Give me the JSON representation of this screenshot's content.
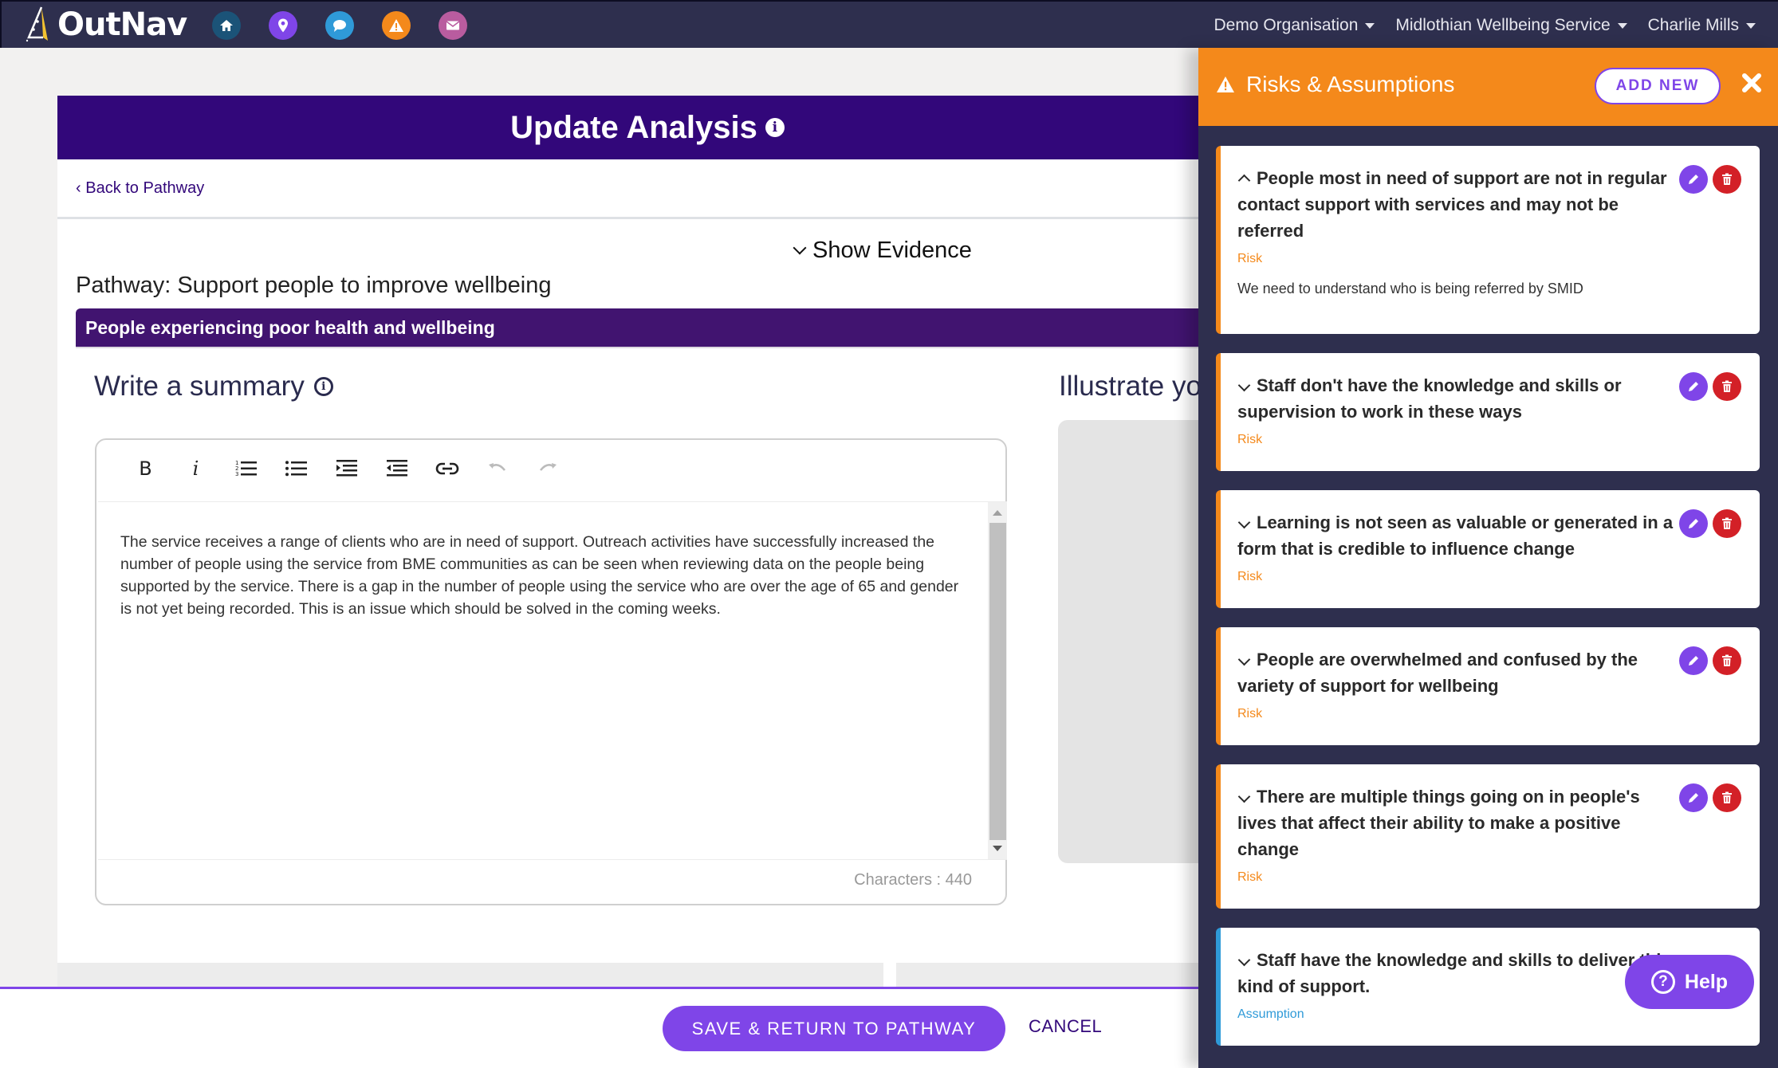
{
  "navbar": {
    "logo_text": "OutNav",
    "icons": [
      {
        "name": "home-icon",
        "color": "#1b5378"
      },
      {
        "name": "map-pin-icon",
        "color": "#7f45e8"
      },
      {
        "name": "chat-icon",
        "color": "#2f9ad8"
      },
      {
        "name": "warning-icon",
        "color": "#f4891b"
      },
      {
        "name": "mail-icon",
        "color": "#b95c9f"
      }
    ],
    "menus": [
      {
        "label": "Demo Organisation"
      },
      {
        "label": "Midlothian Wellbeing Service"
      },
      {
        "label": "Charlie Mills"
      }
    ]
  },
  "main": {
    "title": "Update Analysis",
    "info_glyph": "i",
    "back_link": "Back to Pathway",
    "back_glyph": "‹",
    "show_evidence": "Show Evidence",
    "pathway_label": "Pathway: Support people to improve wellbeing",
    "outcome": "People experiencing poor health and wellbeing",
    "summary_heading": "Write a summary",
    "illustrate_heading": "Illustrate your",
    "editor": {
      "toolbar": {
        "bold": "B",
        "italic": "i"
      },
      "content": "The service receives a range of clients who are in need of support. Outreach activities have successfully increased the number of people using the service from BME communities as can be seen when reviewing data on the people being supported by the service. There is a gap in the number of people using the service who are over the age of 65 and gender is not yet being recorded. This is an issue which should be solved in the coming weeks.",
      "char_count": "Characters : 440"
    }
  },
  "footer": {
    "save_label": "SAVE & RETURN TO PATHWAY",
    "cancel_label": "CANCEL"
  },
  "panel": {
    "title": "Risks & Assumptions",
    "add_new": "ADD NEW",
    "colors": {
      "header": "#f4891b",
      "risk": "#f4891b",
      "assumption": "#2f9ad8",
      "edit": "#7f45e8",
      "delete": "#d32027"
    },
    "items": [
      {
        "title": "People most in need of support are not in regular contact support with services and may not be referred",
        "type": "Risk",
        "expanded": true,
        "description": "We need to understand who is being referred by SMID"
      },
      {
        "title": "Staff don't have the knowledge and skills or supervision to work in these ways",
        "type": "Risk",
        "expanded": false
      },
      {
        "title": "Learning is not seen as valuable or generated in a form that is credible to influence change",
        "type": "Risk",
        "expanded": false
      },
      {
        "title": "People are overwhelmed and confused by the variety of support for wellbeing",
        "type": "Risk",
        "expanded": false
      },
      {
        "title": "There are multiple things going on in people's lives that affect their ability to make a positive change",
        "type": "Risk",
        "expanded": false
      },
      {
        "title": "Staff have the knowledge and skills to deliver this kind of support.",
        "type": "Assumption",
        "expanded": false
      }
    ]
  },
  "help": {
    "label": "Help",
    "glyph": "?"
  }
}
